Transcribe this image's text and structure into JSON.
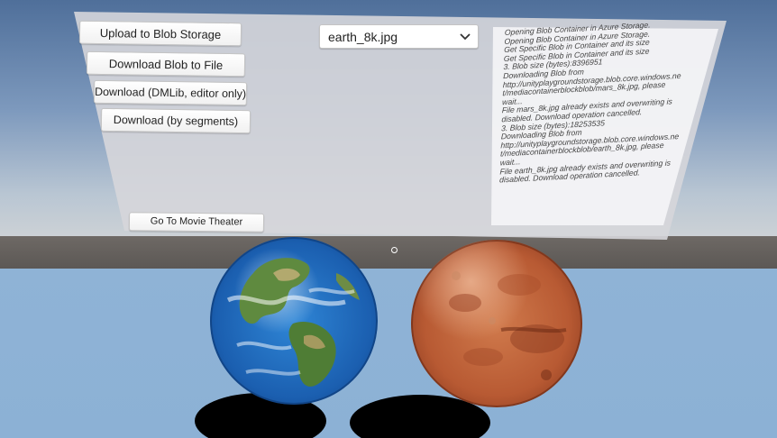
{
  "panel": {
    "buttons": {
      "upload": "Upload to Blob Storage",
      "download_file": "Download Blob to File",
      "download_dmlib": "Download (DMLib, editor only)",
      "download_segments": "Download (by segments)",
      "movie_theater": "Go To Movie Theater"
    },
    "file_select": {
      "value": "earth_8k.jpg"
    },
    "log_lines": [
      "Opening Blob Container in Azure Storage.",
      "Opening Blob Container in Azure Storage.",
      "Get Specific Blob in Container and its size",
      "Get Specific Blob in Container and its size",
      "3. Blob size (bytes):8396951",
      "Downloading Blob from",
      "http://unityplaygroundstorage.blob.core.windows.ne",
      "t/mediacontainerblockblob/mars_8k.jpg, please",
      "wait...",
      "File mars_8k.jpg already exists and overwriting is",
      "disabled. Download operation cancelled.",
      "3. Blob size (bytes):18253535",
      "Downloading Blob from",
      "http://unityplaygroundstorage.blob.core.windows.ne",
      "t/mediacontainerblockblob/earth_8k.jpg, please",
      "wait...",
      "File earth_8k.jpg already exists and overwriting is",
      "disabled. Download operation cancelled."
    ]
  },
  "scene": {
    "objects": [
      "earth-globe",
      "mars-globe"
    ],
    "colors": {
      "floor": "#8cb1d5",
      "horizon": "#5a5653",
      "panel": "#d6d6da"
    }
  }
}
